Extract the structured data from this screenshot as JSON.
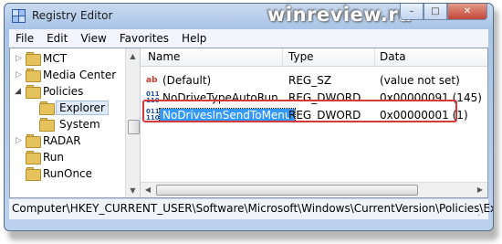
{
  "window": {
    "title": "Registry Editor",
    "watermark": "winreview.ru"
  },
  "controls": {
    "minimize": "–",
    "maximize": "□",
    "close": "✕"
  },
  "menu": [
    "File",
    "Edit",
    "View",
    "Favorites",
    "Help"
  ],
  "tree": [
    {
      "label": "MCT",
      "expanded": false
    },
    {
      "label": "Media Center",
      "expanded": false
    },
    {
      "label": "Policies",
      "expanded": true
    },
    {
      "label": "Explorer",
      "selected": true
    },
    {
      "label": "System"
    },
    {
      "label": "RADAR",
      "expanded": false
    },
    {
      "label": "Run"
    },
    {
      "label": "RunOnce"
    }
  ],
  "columns": {
    "name": "Name",
    "type": "Type",
    "data": "Data"
  },
  "values": [
    {
      "icon": "string-value-icon",
      "name": "(Default)",
      "type": "REG_SZ",
      "data": "(value not set)"
    },
    {
      "icon": "dword-value-icon",
      "name": "NoDriveTypeAutoRun",
      "type": "REG_DWORD",
      "data": "0x00000091 (145)"
    },
    {
      "icon": "dword-value-icon",
      "name": "NoDrivesInSendToMenu",
      "type": "REG_DWORD",
      "data": "0x00000001 (1)",
      "selected": true
    }
  ],
  "status": {
    "path": "Computer\\HKEY_CURRENT_USER\\Software\\Microsoft\\Windows\\CurrentVersion\\Policies\\Exp"
  },
  "colors": {
    "selection": "#3399ff",
    "highlight_box": "#d33b3b"
  }
}
